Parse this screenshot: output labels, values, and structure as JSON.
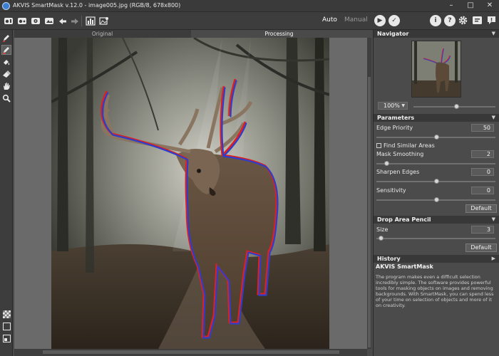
{
  "window": {
    "title": "AKVIS SmartMask v.12.0 - image005.jpg (RGB/8, 678x800)",
    "controls": [
      "minimize",
      "maximize",
      "close"
    ]
  },
  "toolbar": {
    "left_icons": [
      "open-image-icon",
      "save-image-icon",
      "batch-icon",
      "print-icon",
      "undo-icon",
      "redo-icon",
      "show-mask-icon",
      "replace-background-icon"
    ],
    "mode_auto": "Auto",
    "mode_manual": "Manual",
    "active_mode": "Auto",
    "right_icons": [
      "info-icon",
      "help-icon",
      "settings-icon",
      "tutorial-icon",
      "notifications-icon"
    ]
  },
  "tools": [
    "drop-pencil-icon",
    "keep-pencil-icon",
    "magic-tube-icon",
    "eraser-icon",
    "hand-icon",
    "zoom-icon"
  ],
  "bottom_tools": [
    "checkerboard-icon",
    "background-color-icon",
    "view-mode-icon"
  ],
  "view_tabs": {
    "original": "Original",
    "processing": "Processing",
    "active": "Processing"
  },
  "navigator": {
    "title": "Navigator",
    "zoom": "100%",
    "zoom_slider_fraction": 0.5
  },
  "parameters": {
    "title": "Parameters",
    "edge_priority": {
      "label": "Edge Priority",
      "value": "50",
      "fraction": 0.5
    },
    "find_similar_areas": {
      "label": "Find Similar Areas",
      "checked": false
    },
    "mask_smoothing": {
      "label": "Mask Smoothing",
      "value": "2",
      "fraction": 0.09
    },
    "sharpen_edges": {
      "label": "Sharpen Edges",
      "value": "0",
      "fraction": 0.5
    },
    "sensitivity": {
      "label": "Sensitivity",
      "value": "0",
      "fraction": 0.5
    },
    "default_label": "Default"
  },
  "drop_area_pencil": {
    "title": "Drop Area Pencil",
    "size": {
      "label": "Size",
      "value": "3",
      "fraction": 0.02
    },
    "default_label": "Default"
  },
  "history": {
    "title": "History"
  },
  "about": {
    "title": "AKVIS SmartMask",
    "text": "The program makes even a difficult selection incredibly simple. The software provides powerful tools for masking objects on images and removing backgrounds. With SmartMask, you can spend less of your time on selection of objects and more of it on creativity."
  },
  "colors": {
    "mask_outline_inner": "#2f3ec8",
    "mask_outline_outer": "#e02020",
    "panel_bg": "#4b4b4b",
    "header_bg": "#383838"
  }
}
